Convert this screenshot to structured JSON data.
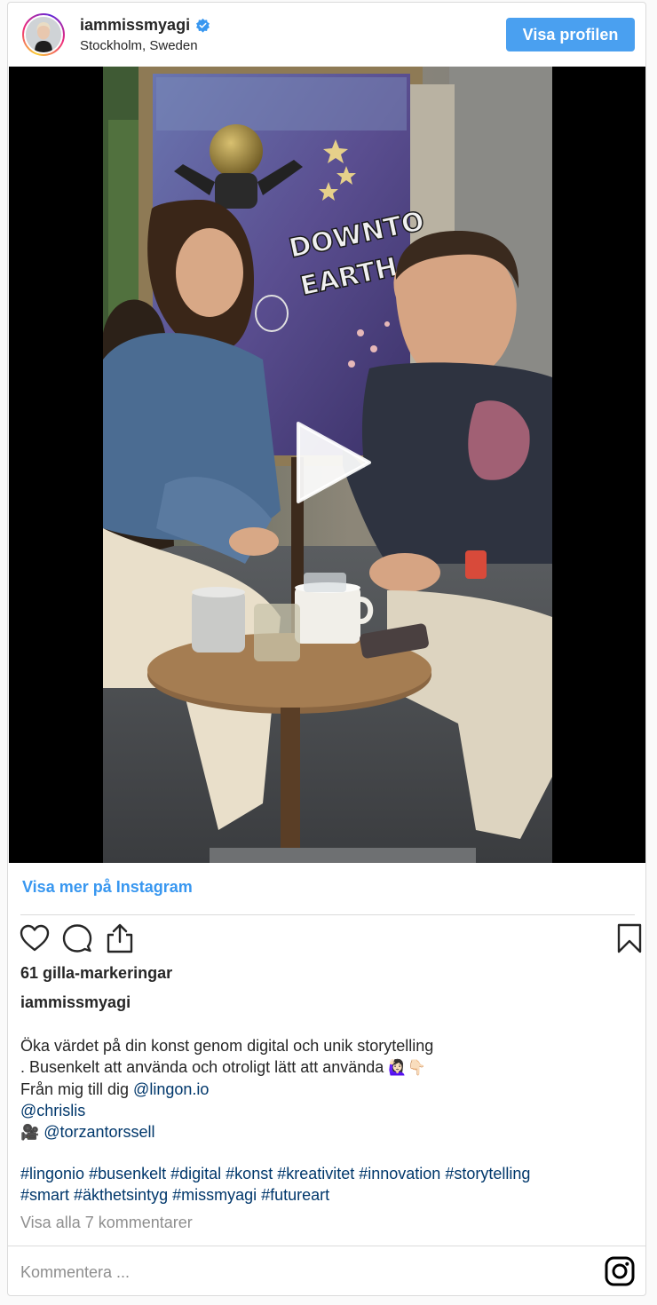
{
  "header": {
    "username": "iammissmyagi",
    "location": "Stockholm, Sweden",
    "view_profile_label": "Visa profilen"
  },
  "media": {
    "artwork_text_1": "DOWNTO",
    "artwork_text_2": "EARTH"
  },
  "post": {
    "view_more_label": "Visa mer på Instagram",
    "likes": "61 gilla-markeringar",
    "caption_user": "iammissmyagi",
    "caption": {
      "line1": "Öka värdet på din konst genom digital och unik storytelling",
      "line2_text": ". Busenkelt att använda och otroligt lätt att använda",
      "line2_emoji": "🙋🏻‍♀️👇🏻",
      "line3_text": "Från mig till dig ",
      "line3_mention": "@lingon.io",
      "line4_mention": "@chrislis",
      "line5_emoji": "🎥",
      "line5_mention": "@torzantorssell"
    },
    "hashtags": {
      "line1": "#lingonio #busenkelt #digital #konst #kreativitet #innovation #storytelling",
      "line2": "#smart #äkthetsintyg #missmyagi #futureart"
    },
    "all_comments_label": "Visa alla 7 kommentarer",
    "comment_placeholder": "Kommentera ..."
  },
  "colors": {
    "accent": "#4aa0f0",
    "link": "#3897f0",
    "mention": "#00376b",
    "muted": "#8e8e8e"
  },
  "icons": {
    "like": "heart-icon",
    "comment": "comment-icon",
    "share": "share-icon",
    "save": "bookmark-icon",
    "verified": "verified-badge-icon",
    "play": "play-icon",
    "logo": "instagram-logo-icon"
  }
}
